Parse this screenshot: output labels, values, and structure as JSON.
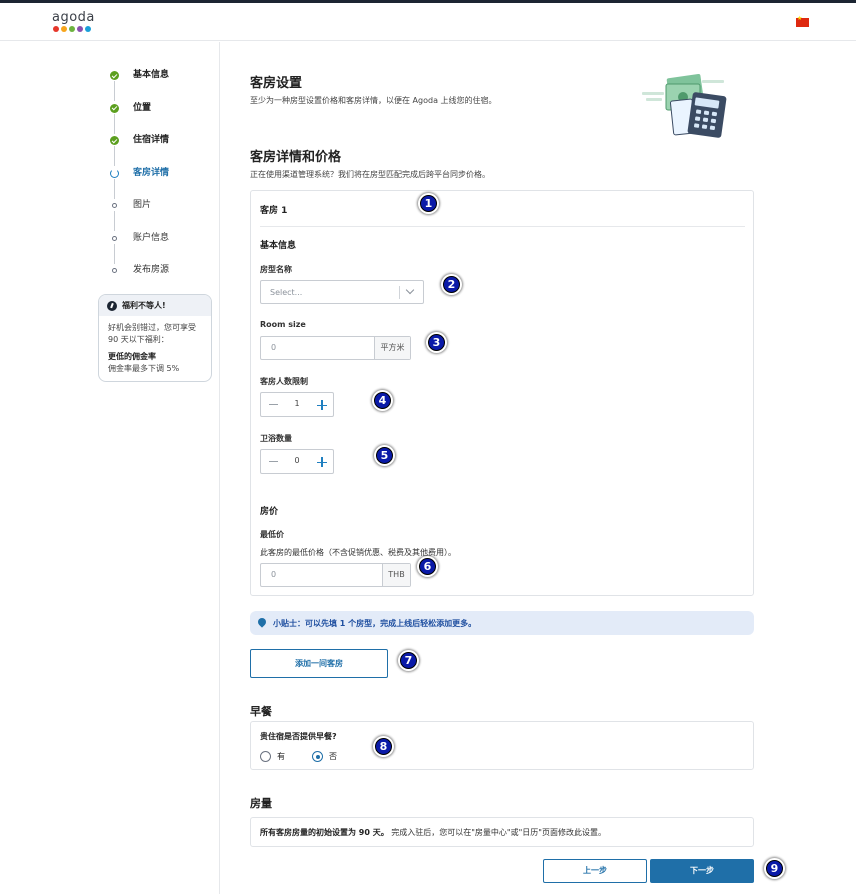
{
  "header": {
    "logo_text": "agoda",
    "logo_dot_colors": [
      "#e6372b",
      "#f7a51c",
      "#6db33f",
      "#8a4fae",
      "#1a9fd9"
    ],
    "flag": "china-flag"
  },
  "sidebar": {
    "steps": [
      {
        "label": "基本信息",
        "state": "done"
      },
      {
        "label": "位置",
        "state": "done"
      },
      {
        "label": "住宿详情",
        "state": "done"
      },
      {
        "label": "客房详情",
        "state": "current"
      },
      {
        "label": "图片",
        "state": "todo"
      },
      {
        "label": "账户信息",
        "state": "todo"
      },
      {
        "label": "发布房源",
        "state": "todo"
      }
    ],
    "promo": {
      "title": "福利不等人!",
      "text": "好机会别错过，您可享受90 天以下福利：",
      "benefit_title": "更低的佣金率",
      "benefit_text": "佣金率最多下调 5%"
    }
  },
  "main": {
    "title": "客房设置",
    "subtitle": "至少为一种房型设置价格和客房详情，以便在 Agoda 上线您的住宿。",
    "section_title": "客房详情和价格",
    "section_subtitle": "正在使用渠道管理系统？我们将在房型匹配完成后跨平台同步价格。",
    "room": {
      "title": "客房 1",
      "basic_info": "基本信息",
      "room_type_label": "房型名称",
      "room_type_placeholder": "Select...",
      "room_size_label": "Room size",
      "room_size_value": "0",
      "room_size_unit": "平方米",
      "occupancy_label": "客房人数限制",
      "occupancy_value": "1",
      "bathrooms_label": "卫浴数量",
      "bathrooms_value": "0",
      "price_section": "房价",
      "min_price_label": "最低价",
      "min_price_note": "此客房的最低价格（不含促销优惠、税费及其他费用）。",
      "min_price_value": "0",
      "currency": "THB"
    },
    "tip": "小贴士：可以先填 1 个房型，完成上线后轻松添加更多。",
    "add_room_button": "添加一间客房",
    "breakfast": {
      "title": "早餐",
      "question": "贵住宿是否提供早餐?",
      "options": [
        "有",
        "否"
      ],
      "selected": "否"
    },
    "inventory": {
      "title": "房量",
      "text_bold": "所有客房房量的初始设置为 90 天。",
      "text_rest": "完成入驻后，您可以在\"房量中心\"或\"日历\"页面修改此设置。"
    },
    "prev_button": "上一步",
    "next_button": "下一步"
  },
  "markers": [
    "1",
    "2",
    "3",
    "4",
    "5",
    "6",
    "7",
    "8",
    "9"
  ],
  "colors": {
    "accent": "#1f6fa8",
    "done_green": "#5c9f1f",
    "marker_blue": "#0a1aa8"
  }
}
